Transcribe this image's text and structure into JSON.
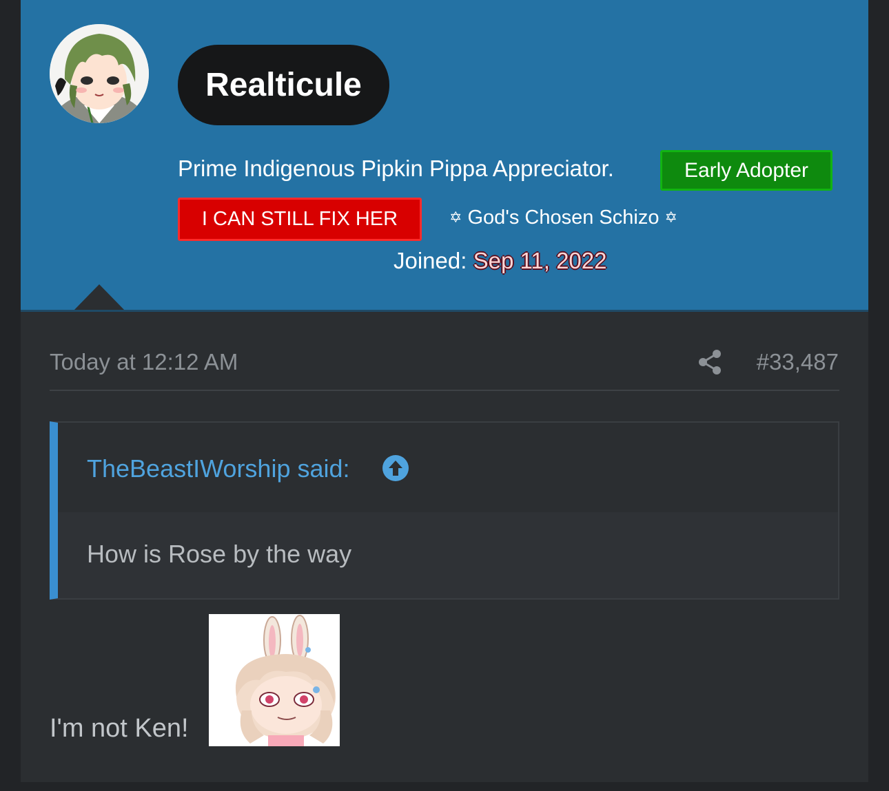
{
  "user": {
    "name": "Realticule",
    "title": "Prime Indigenous Pipkin Pippa Appreciator.",
    "banners": {
      "early_adopter": "Early Adopter",
      "fix_her": "I CAN STILL FIX HER",
      "schizo": "God's Chosen Schizo",
      "schizo_star": "✡"
    },
    "joined_label": "Joined:",
    "joined_date": "Sep 11, 2022"
  },
  "message": {
    "time": "Today at 12:12 AM",
    "post_number": "#33,487",
    "quote": {
      "author": "TheBeastIWorship said:",
      "text": "How is Rose by the way"
    },
    "text": "I'm not Ken!"
  },
  "colors": {
    "header_bg": "#2472a4",
    "early_adopter": "#0e8a0e",
    "fix_her": "#d80000",
    "quote_accent": "#3a8fd0",
    "link": "#4fa3de"
  },
  "icons": {
    "share": "share-icon",
    "quote_jump": "arrow-up-circle-icon",
    "avatar": "avatar",
    "emote": "bunny-girl-emote"
  }
}
